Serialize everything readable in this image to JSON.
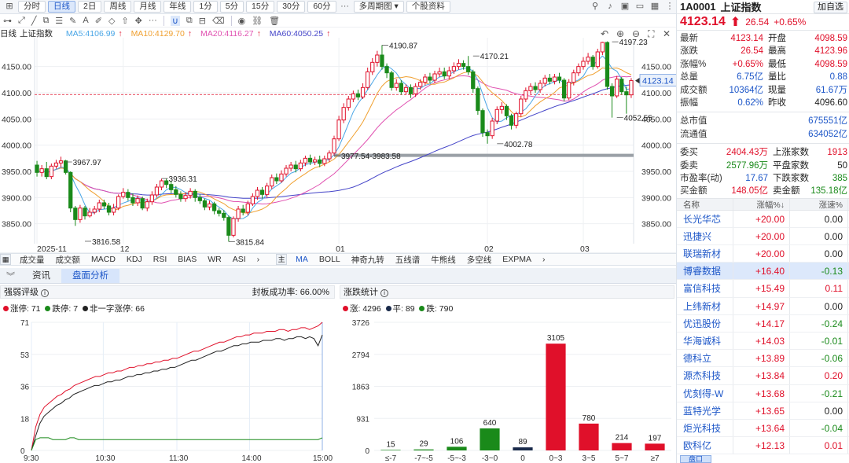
{
  "toolbar": {
    "buttons": [
      "分时",
      "日线",
      "2日",
      "周线",
      "月线",
      "年线",
      "1分",
      "5分",
      "15分",
      "30分",
      "60分"
    ],
    "active": "日线",
    "multi_period": "多周期图",
    "stock_data": "个股资料"
  },
  "chart_info": {
    "period": "日线",
    "index": "上证指数",
    "ma5": "MA5:4106.99",
    "ma10": "MA10:4129.70",
    "ma20": "MA20:4116.27",
    "ma60": "MA60:4050.25"
  },
  "colors": {
    "up": "#e0102a",
    "down": "#1a8a1a",
    "ma5": "#4aa6e6",
    "ma10": "#f0a030",
    "ma20": "#e050b0",
    "ma60": "#4444c8",
    "accent": "#1e57c8"
  },
  "kline": {
    "y_ticks": [
      "4150.00",
      "4100.00",
      "4050.00",
      "4000.00",
      "3950.00",
      "3900.00",
      "3850.00"
    ],
    "y_tick_values": [
      4150,
      4100,
      4050,
      4000,
      3950,
      3900,
      3850
    ],
    "ylim": [
      3812,
      4205
    ],
    "dashed_level": 4096.6,
    "x_labels": [
      {
        "label": "2025-11",
        "i": 0
      },
      {
        "label": "12",
        "i": 18
      },
      {
        "label": "01",
        "i": 63
      },
      {
        "label": "02",
        "i": 94
      },
      {
        "label": "03",
        "i": 114
      }
    ],
    "annotations": [
      {
        "text": "3967.97",
        "i": 6,
        "v": 3967.97
      },
      {
        "text": "3816.58",
        "i": 10,
        "v": 3816.58
      },
      {
        "text": "3936.31",
        "i": 26,
        "v": 3936.31
      },
      {
        "text": "3815.84",
        "i": 40,
        "v": 3815.84
      },
      {
        "text": "3977.54-3983.58",
        "i": 62,
        "v": 3980
      },
      {
        "text": "4190.87",
        "i": 72,
        "v": 4190.87
      },
      {
        "text": "4170.21",
        "i": 91,
        "v": 4170.21
      },
      {
        "text": "4002.78",
        "i": 96,
        "v": 4002.78
      },
      {
        "text": "4197.23",
        "i": 120,
        "v": 4197.23
      },
      {
        "text": "4052.55",
        "i": 121,
        "v": 4052.55
      }
    ],
    "last_price": "4123.14",
    "candles": [
      [
        3962,
        3948,
        3970,
        3940
      ],
      [
        3948,
        3955,
        3962,
        3940
      ],
      [
        3955,
        3940,
        3968,
        3935
      ],
      [
        3940,
        3960,
        3965,
        3935
      ],
      [
        3960,
        3966,
        3972,
        3955
      ],
      [
        3966,
        3970,
        3978,
        3958
      ],
      [
        3970,
        3948,
        3972,
        3944
      ],
      [
        3948,
        3880,
        3950,
        3872
      ],
      [
        3880,
        3858,
        3884,
        3846
      ],
      [
        3858,
        3880,
        3886,
        3852
      ],
      [
        3880,
        3865,
        3884,
        3858
      ],
      [
        3865,
        3872,
        3880,
        3862
      ],
      [
        3872,
        3878,
        3884,
        3868
      ],
      [
        3878,
        3890,
        3896,
        3872
      ],
      [
        3890,
        3884,
        3896,
        3878
      ],
      [
        3884,
        3872,
        3890,
        3866
      ],
      [
        3872,
        3880,
        3888,
        3866
      ],
      [
        3880,
        3902,
        3906,
        3876
      ],
      [
        3902,
        3910,
        3918,
        3898
      ],
      [
        3910,
        3900,
        3916,
        3894
      ],
      [
        3900,
        3890,
        3908,
        3884
      ],
      [
        3890,
        3898,
        3904,
        3884
      ],
      [
        3898,
        3880,
        3902,
        3876
      ],
      [
        3880,
        3892,
        3898,
        3874
      ],
      [
        3892,
        3905,
        3912,
        3886
      ],
      [
        3905,
        3920,
        3926,
        3900
      ],
      [
        3920,
        3932,
        3936,
        3914
      ],
      [
        3932,
        3925,
        3936,
        3918
      ],
      [
        3925,
        3915,
        3932,
        3908
      ],
      [
        3915,
        3906,
        3922,
        3900
      ],
      [
        3906,
        3898,
        3912,
        3892
      ],
      [
        3898,
        3904,
        3910,
        3892
      ],
      [
        3904,
        3912,
        3918,
        3898
      ],
      [
        3912,
        3900,
        3916,
        3892
      ],
      [
        3900,
        3894,
        3906,
        3888
      ],
      [
        3894,
        3882,
        3898,
        3876
      ],
      [
        3882,
        3888,
        3894,
        3876
      ],
      [
        3888,
        3875,
        3892,
        3868
      ],
      [
        3875,
        3870,
        3880,
        3864
      ],
      [
        3870,
        3862,
        3876,
        3856
      ],
      [
        3862,
        3828,
        3866,
        3816
      ],
      [
        3828,
        3860,
        3864,
        3824
      ],
      [
        3860,
        3878,
        3884,
        3854
      ],
      [
        3878,
        3872,
        3886,
        3866
      ],
      [
        3872,
        3888,
        3894,
        3866
      ],
      [
        3888,
        3902,
        3908,
        3884
      ],
      [
        3902,
        3914,
        3920,
        3896
      ],
      [
        3914,
        3906,
        3920,
        3898
      ],
      [
        3906,
        3922,
        3928,
        3900
      ],
      [
        3922,
        3938,
        3944,
        3916
      ],
      [
        3938,
        3932,
        3946,
        3926
      ],
      [
        3932,
        3945,
        3952,
        3928
      ],
      [
        3945,
        3956,
        3962,
        3940
      ],
      [
        3956,
        3962,
        3968,
        3950
      ],
      [
        3962,
        3955,
        3970,
        3948
      ],
      [
        3955,
        3966,
        3972,
        3950
      ],
      [
        3966,
        3975,
        3980,
        3960
      ],
      [
        3975,
        3968,
        3982,
        3962
      ],
      [
        3968,
        3972,
        3978,
        3962
      ],
      [
        3972,
        3965,
        3980,
        3958
      ],
      [
        3965,
        3974,
        3980,
        3960
      ],
      [
        3974,
        3985,
        3990,
        3968
      ],
      [
        3985,
        4012,
        4018,
        3980
      ],
      [
        4012,
        4048,
        4056,
        4008
      ],
      [
        4048,
        4072,
        4080,
        4042
      ],
      [
        4072,
        4088,
        4094,
        4066
      ],
      [
        4088,
        4098,
        4104,
        4082
      ],
      [
        4098,
        4092,
        4106,
        4086
      ],
      [
        4092,
        4110,
        4118,
        4088
      ],
      [
        4110,
        4140,
        4148,
        4106
      ],
      [
        4140,
        4158,
        4166,
        4134
      ],
      [
        4158,
        4172,
        4180,
        4150
      ],
      [
        4172,
        4150,
        4190.87,
        4144
      ],
      [
        4150,
        4138,
        4156,
        4128
      ],
      [
        4138,
        4110,
        4142,
        4104
      ],
      [
        4110,
        4118,
        4126,
        4104
      ],
      [
        4118,
        4102,
        4124,
        4096
      ],
      [
        4102,
        4110,
        4116,
        4096
      ],
      [
        4110,
        4098,
        4116,
        4090
      ],
      [
        4098,
        4112,
        4118,
        4092
      ],
      [
        4112,
        4120,
        4126,
        4106
      ],
      [
        4120,
        4130,
        4136,
        4114
      ],
      [
        4130,
        4124,
        4138,
        4118
      ],
      [
        4124,
        4136,
        4142,
        4118
      ],
      [
        4136,
        4140,
        4148,
        4130
      ],
      [
        4140,
        4132,
        4148,
        4126
      ],
      [
        4132,
        4142,
        4150,
        4126
      ],
      [
        4142,
        4150,
        4158,
        4136
      ],
      [
        4150,
        4156,
        4164,
        4144
      ],
      [
        4156,
        4150,
        4162,
        4144
      ],
      [
        4150,
        4140,
        4170.21,
        4134
      ],
      [
        4140,
        4108,
        4144,
        4100
      ],
      [
        4108,
        4066,
        4112,
        4058
      ],
      [
        4066,
        4024,
        4070,
        4016
      ],
      [
        4024,
        4018,
        4030,
        4002.78
      ],
      [
        4018,
        4046,
        4052,
        4012
      ],
      [
        4046,
        4068,
        4074,
        4040
      ],
      [
        4068,
        4074,
        4082,
        4060
      ],
      [
        4074,
        4056,
        4078,
        4048
      ],
      [
        4056,
        4038,
        4060,
        4030
      ],
      [
        4038,
        4060,
        4064,
        4032
      ],
      [
        4060,
        4088,
        4094,
        4054
      ],
      [
        4088,
        4104,
        4110,
        4082
      ],
      [
        4104,
        4112,
        4118,
        4098
      ],
      [
        4112,
        4106,
        4120,
        4100
      ],
      [
        4106,
        4118,
        4124,
        4100
      ],
      [
        4118,
        4128,
        4134,
        4112
      ],
      [
        4128,
        4122,
        4136,
        4116
      ],
      [
        4122,
        4130,
        4136,
        4116
      ],
      [
        4130,
        4124,
        4138,
        4118
      ],
      [
        4124,
        4090,
        4128,
        4084
      ],
      [
        4090,
        4120,
        4126,
        4086
      ],
      [
        4120,
        4138,
        4144,
        4114
      ],
      [
        4138,
        4150,
        4156,
        4132
      ],
      [
        4150,
        4160,
        4168,
        4144
      ],
      [
        4160,
        4168,
        4176,
        4154
      ],
      [
        4168,
        4150,
        4172,
        4144
      ],
      [
        4150,
        4178,
        4184,
        4146
      ],
      [
        4178,
        4196,
        4197.23,
        4172
      ],
      [
        4196,
        4112,
        4198,
        4106
      ],
      [
        4112,
        4094,
        4118,
        4052.55
      ],
      [
        4094,
        4126,
        4132,
        4090
      ],
      [
        4126,
        4102,
        4130,
        4096
      ],
      [
        4102,
        4096,
        4112,
        4060
      ],
      [
        4096,
        4123.14,
        4128,
        4090
      ]
    ]
  },
  "indicator_tabs": {
    "left": [
      "成交量",
      "成交额",
      "MACD",
      "KDJ",
      "RSI",
      "BIAS",
      "WR",
      "ASI"
    ],
    "right_box": "主",
    "right": [
      "MA",
      "BOLL",
      "神奇九转",
      "五线谱",
      "牛熊线",
      "多空线",
      "EXPMA"
    ],
    "right_selected": "MA"
  },
  "bottom_tabs": [
    "资讯",
    "盘面分析"
  ],
  "bottom_tabs_active": "盘面分析",
  "strength": {
    "title": "强弱评级",
    "rate_label": "封板成功率:",
    "rate_value": "66.00%",
    "legend": [
      {
        "label": "涨停:",
        "value": "71",
        "color": "#e0102a"
      },
      {
        "label": "跌停:",
        "value": "7",
        "color": "#1a8a1a"
      },
      {
        "label": "非一字涨停:",
        "value": "66",
        "color": "#222222"
      }
    ],
    "y_ticks": [
      "71",
      "53",
      "36",
      "18",
      "0"
    ],
    "y_max": 71,
    "x_labels": [
      "9:30",
      "10:30",
      "11:30",
      "14:00",
      "15:00"
    ],
    "limit_up": [
      0,
      13,
      20,
      24,
      26,
      28,
      30,
      31,
      33,
      34,
      36,
      37,
      38,
      39,
      40,
      41,
      41,
      42,
      43,
      43,
      44,
      44,
      45,
      46,
      46,
      47,
      47,
      48,
      48,
      49,
      49,
      50,
      50,
      51,
      51,
      52,
      53,
      54,
      55,
      55,
      56,
      57,
      58,
      59,
      60,
      60,
      61,
      62,
      63,
      63,
      64,
      64,
      65,
      65,
      65,
      66,
      66,
      66,
      67,
      67,
      66,
      67,
      67,
      68,
      68,
      67,
      68,
      69,
      71
    ],
    "limit_up_nonyz": [
      0,
      8,
      15,
      19,
      21,
      23,
      25,
      26,
      28,
      29,
      31,
      32,
      33,
      34,
      35,
      36,
      36,
      37,
      38,
      38,
      39,
      39,
      40,
      41,
      41,
      42,
      42,
      43,
      43,
      44,
      44,
      45,
      45,
      46,
      46,
      47,
      48,
      49,
      50,
      50,
      51,
      52,
      53,
      54,
      55,
      55,
      56,
      57,
      58,
      58,
      59,
      59,
      60,
      60,
      60,
      61,
      61,
      61,
      62,
      62,
      61,
      62,
      62,
      63,
      63,
      62,
      63,
      62,
      58,
      64
    ],
    "limit_down": [
      0,
      6,
      7,
      7,
      7,
      6,
      6,
      6,
      6,
      7,
      7,
      6,
      6,
      6,
      6,
      6,
      6,
      6,
      6,
      6,
      6,
      6,
      6,
      6,
      6,
      6,
      6,
      6,
      6,
      6,
      6,
      6,
      6,
      6,
      6,
      6,
      6,
      6,
      6,
      6,
      6,
      6,
      6,
      6,
      6,
      6,
      6,
      6,
      6,
      6,
      6,
      6,
      6,
      6,
      6,
      6,
      6,
      6,
      6,
      6,
      6,
      6,
      6,
      6,
      6,
      6,
      6,
      6,
      7
    ]
  },
  "updown": {
    "title": "涨跌统计",
    "legend": [
      {
        "label": "涨:",
        "value": "4296",
        "color": "#e0102a"
      },
      {
        "label": "平:",
        "value": "89",
        "color": "#1a2a4a"
      },
      {
        "label": "跌:",
        "value": "790",
        "color": "#1a8a1a"
      }
    ],
    "y_ticks": [
      "3726",
      "2794",
      "1863",
      "931",
      "0"
    ],
    "y_max": 3726
  },
  "chart_data": {
    "type": "bar",
    "categories": [
      "≤-7",
      "-7~-5",
      "-5~-3",
      "-3~0",
      "0",
      "0~3",
      "3~5",
      "5~7",
      "≥7"
    ],
    "values": [
      15,
      29,
      106,
      640,
      89,
      3105,
      780,
      214,
      197
    ],
    "colors": [
      "#1a8a1a",
      "#1a8a1a",
      "#1a8a1a",
      "#1a8a1a",
      "#1a2a4a",
      "#e0102a",
      "#e0102a",
      "#e0102a",
      "#e0102a"
    ],
    "ylim": [
      0,
      3726
    ]
  },
  "quote": {
    "code": "1A0001",
    "name": "上证指数",
    "add_button": "加自选",
    "price": "4123.14",
    "change": "26.54",
    "change_pct": "+0.65%",
    "rows": [
      {
        "k": "最新",
        "v": "4123.14",
        "vc": "red",
        "k2": "开盘",
        "v2": "4098.59",
        "v2c": "red"
      },
      {
        "k": "涨跌",
        "v": "26.54",
        "vc": "red",
        "k2": "最高",
        "v2": "4123.96",
        "v2c": "red"
      },
      {
        "k": "涨幅%",
        "v": "+0.65%",
        "vc": "red",
        "k2": "最低",
        "v2": "4098.59",
        "v2c": "red"
      },
      {
        "k": "总量",
        "v": "6.75亿",
        "vc": "blue",
        "k2": "量比",
        "v2": "0.88",
        "v2c": "blue"
      },
      {
        "k": "成交额",
        "v": "10364亿",
        "vc": "blue",
        "k2": "现量",
        "v2": "61.67万",
        "v2c": "blue"
      },
      {
        "k": "振幅",
        "v": "0.62%",
        "vc": "blue",
        "k2": "昨收",
        "v2": "4096.60",
        "v2c": "plain"
      }
    ],
    "rows2": [
      {
        "k": "总市值",
        "v": "675551亿",
        "vc": "blue"
      },
      {
        "k": "流通值",
        "v": "634052亿",
        "vc": "blue"
      }
    ],
    "rows3": [
      {
        "k": "委买",
        "v": "2404.43万",
        "vc": "red",
        "k2": "上涨家数",
        "v2": "1913",
        "v2c": "red"
      },
      {
        "k": "委卖",
        "v": "2577.96万",
        "vc": "green",
        "k2": "平盘家数",
        "v2": "50",
        "v2c": "plain"
      },
      {
        "k": "市盈率(动)",
        "v": "17.67",
        "vc": "blue",
        "k2": "下跌家数",
        "v2": "385",
        "v2c": "green"
      },
      {
        "k": "买金额",
        "v": "148.05亿",
        "vc": "red",
        "k2": "卖金额",
        "v2": "135.18亿",
        "v2c": "green"
      }
    ]
  },
  "stock_table": {
    "headers": [
      "名称",
      "涨幅%↓",
      "涨速%"
    ],
    "rows": [
      {
        "name": "长光华芯",
        "pct": "+20.00",
        "speed": "0.00",
        "sc": "plain"
      },
      {
        "name": "迅捷兴",
        "pct": "+20.00",
        "speed": "0.00",
        "sc": "plain"
      },
      {
        "name": "联瑞新材",
        "pct": "+20.00",
        "speed": "0.00",
        "sc": "plain"
      },
      {
        "name": "博睿数据",
        "pct": "+16.40",
        "speed": "-0.13",
        "sc": "green"
      },
      {
        "name": "富信科技",
        "pct": "+15.49",
        "speed": "0.11",
        "sc": "red"
      },
      {
        "name": "上纬新材",
        "pct": "+14.97",
        "speed": "0.00",
        "sc": "plain"
      },
      {
        "name": "优迅股份",
        "pct": "+14.17",
        "speed": "-0.24",
        "sc": "green"
      },
      {
        "name": "华海诚科",
        "pct": "+14.03",
        "speed": "-0.01",
        "sc": "green"
      },
      {
        "name": "德科立",
        "pct": "+13.89",
        "speed": "-0.06",
        "sc": "green"
      },
      {
        "name": "源杰科技",
        "pct": "+13.84",
        "speed": "0.20",
        "sc": "red"
      },
      {
        "name": "优刻得-W",
        "pct": "+13.68",
        "speed": "-0.21",
        "sc": "green"
      },
      {
        "name": "蓝特光学",
        "pct": "+13.65",
        "speed": "0.00",
        "sc": "plain"
      },
      {
        "name": "炬光科技",
        "pct": "+13.64",
        "speed": "-0.04",
        "sc": "green"
      },
      {
        "name": "欧科亿",
        "pct": "+12.13",
        "speed": "0.01",
        "sc": "red"
      }
    ],
    "highlighted": "博睿数据",
    "footer": "盘口"
  }
}
